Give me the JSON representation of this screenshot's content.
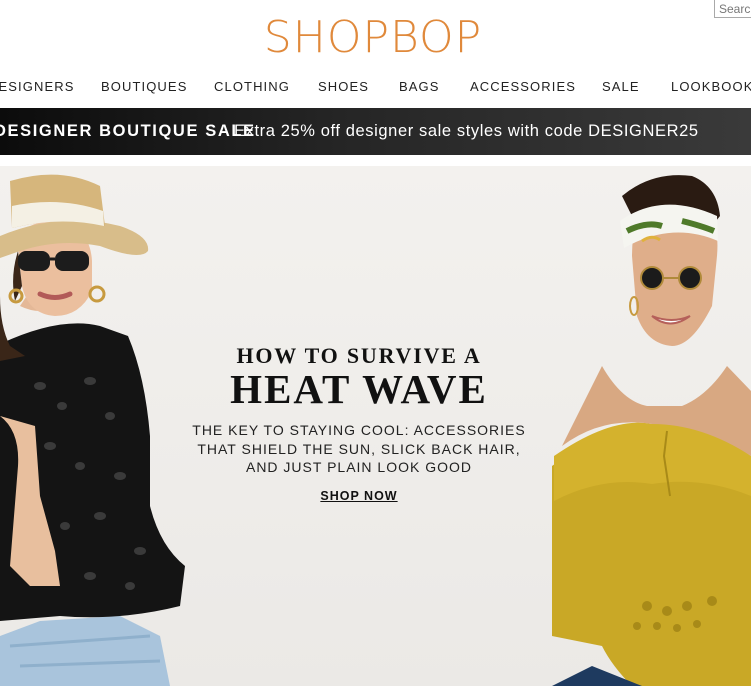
{
  "search": {
    "placeholder": "Search"
  },
  "brand": {
    "logo_text": "SHOPBOP",
    "color": "#e0893b"
  },
  "nav": {
    "items": [
      "DESIGNERS",
      "BOUTIQUES",
      "CLOTHING",
      "SHOES",
      "BAGS",
      "ACCESSORIES",
      "SALE",
      "LOOKBOOKS"
    ]
  },
  "promo": {
    "bold": "DESIGNER BOUTIQUE SALE",
    "text": "Extra 25% off designer sale styles with code DESIGNER25"
  },
  "hero": {
    "kicker": "HOW TO SURVIVE A",
    "title": "HEAT WAVE",
    "subtitle": "THE KEY TO STAYING COOL: ACCESSORIES THAT SHIELD THE SUN, SLICK BACK HAIR, AND JUST PLAIN LOOK GOOD",
    "cta": "SHOP NOW"
  }
}
